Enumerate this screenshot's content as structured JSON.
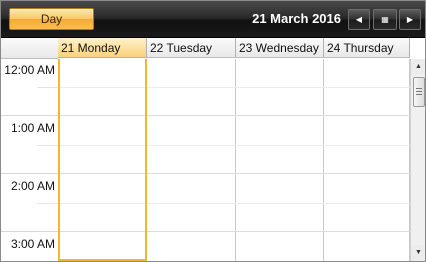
{
  "toolbar": {
    "view_button": "Day",
    "date_title": "21 March 2016",
    "prev_icon": "◀",
    "today_icon": "▦",
    "next_icon": "▶"
  },
  "days": [
    {
      "label": "21 Monday",
      "today": true
    },
    {
      "label": "22 Tuesday",
      "today": false
    },
    {
      "label": "23 Wednesday",
      "today": false
    },
    {
      "label": "24 Thursday",
      "today": false
    }
  ],
  "times": [
    "12:00 AM",
    "1:00 AM",
    "2:00 AM",
    "3:00 AM"
  ],
  "colors": {
    "accent": "#f2b632",
    "toolbar": "#1a1a1a"
  },
  "scrollbar": {
    "up_icon": "▲",
    "down_icon": "▼"
  }
}
